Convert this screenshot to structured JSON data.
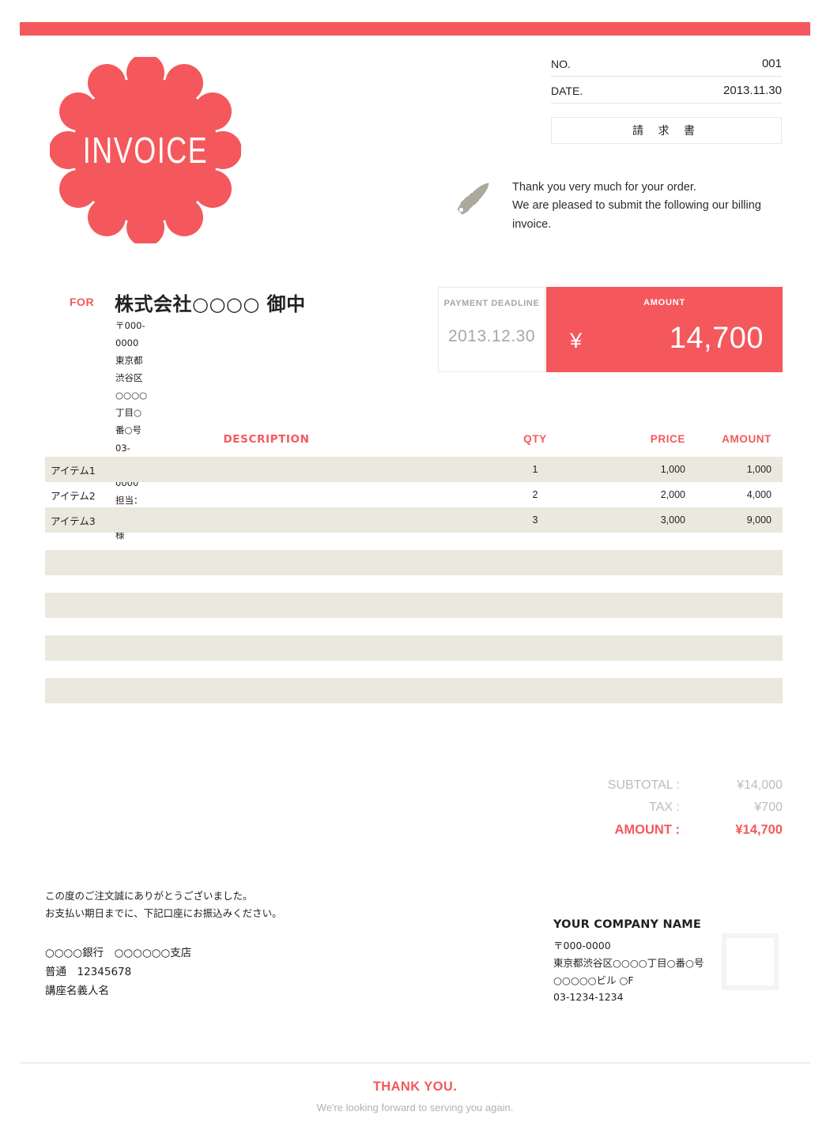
{
  "colors": {
    "accent": "#F4585C",
    "row_alt": "#EBE8DE",
    "muted": "#A9A79F",
    "rule": "#ECE9E1"
  },
  "badge": {
    "label": "INVOICE"
  },
  "header": {
    "no_label": "NO.",
    "no_value": "001",
    "date_label": "DATE.",
    "date_value": "2013.11.30",
    "doc_title": "請 求 書"
  },
  "note": {
    "line1": "Thank you very much for your order.",
    "line2": "We are pleased to submit the following our billing invoice."
  },
  "recipient": {
    "for_label": "FOR",
    "name": "株式会社○○○○ 御中",
    "postal": "〒000-0000",
    "address": "東京都渋谷区○○○○丁目○番○号",
    "phone": "03-0000-0000",
    "contact": "担当：○○○○様"
  },
  "deadline": {
    "title": "PAYMENT DEADLINE",
    "value": "2013.12.30"
  },
  "amount_box": {
    "title": "AMOUNT",
    "currency": "¥",
    "value": "14,700"
  },
  "table": {
    "columns": {
      "description": "DESCRIPTION",
      "qty": "QTY",
      "price": "PRICE",
      "amount": "AMOUNT"
    },
    "rows": [
      {
        "description": "アイテム1",
        "qty": "1",
        "price": "1,000",
        "amount": "1,000"
      },
      {
        "description": "アイテム2",
        "qty": "2",
        "price": "2,000",
        "amount": "4,000"
      },
      {
        "description": "アイテム3",
        "qty": "3",
        "price": "3,000",
        "amount": "9,000"
      }
    ],
    "blank_row_count": 4
  },
  "totals": {
    "subtotal_label": "SUBTOTAL :",
    "subtotal_value": "¥14,000",
    "tax_label": "TAX :",
    "tax_value": "¥700",
    "amount_label": "AMOUNT :",
    "amount_value": "¥14,700"
  },
  "bank": {
    "message_line1": "この度のご注文誠にありがとうございました。",
    "message_line2": "お支払い期日までに、下記口座にお振込みください。",
    "account_line1": "○○○○銀行　○○○○○○支店",
    "account_line2": "普通　12345678",
    "account_line3": "講座名義人名"
  },
  "company": {
    "name": "YOUR COMPANY NAME",
    "postal": "〒000-0000",
    "address": "東京都渋谷区○○○○丁目○番○号",
    "building": "○○○○○ビル ○F",
    "phone": "03-1234-1234"
  },
  "footer": {
    "title": "THANK YOU.",
    "subtitle": "We're looking forward to serving you again."
  }
}
